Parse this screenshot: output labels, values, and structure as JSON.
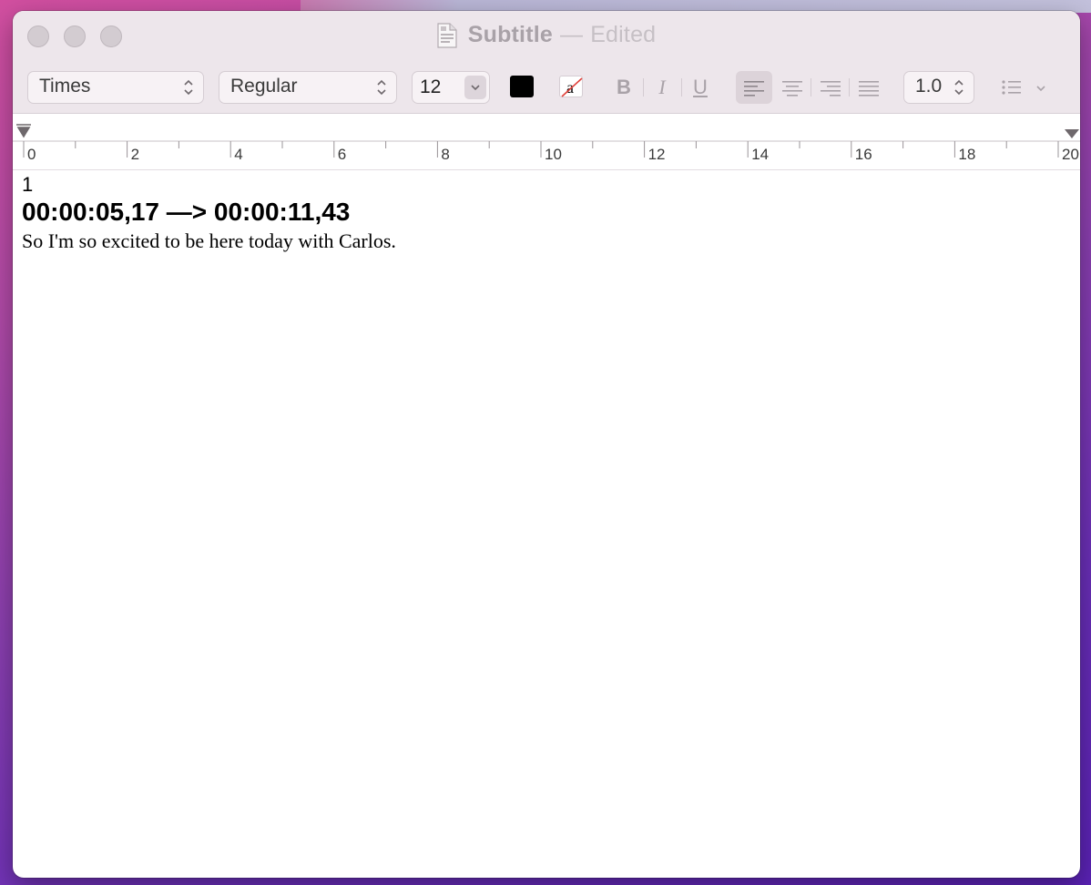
{
  "window": {
    "title": "Subtitle",
    "separator": "—",
    "status": "Edited"
  },
  "toolbar": {
    "font_family": "Times",
    "font_style": "Regular",
    "font_size": "12",
    "text_color": "#000000",
    "bold_label": "B",
    "italic_label": "I",
    "underline_label": "U",
    "line_spacing": "1.0",
    "highlight_glyph": "a"
  },
  "ruler": {
    "labels": [
      "0",
      "2",
      "4",
      "6",
      "8",
      "10",
      "12",
      "14",
      "16",
      "18",
      "20"
    ]
  },
  "document": {
    "index": "1",
    "timing": "00:00:05,17 —> 00:00:11,43",
    "text": "So I'm so excited to be here today with Carlos."
  },
  "colors": {
    "accent_red": "#e0403a",
    "window_chrome": "#ede6eb"
  }
}
